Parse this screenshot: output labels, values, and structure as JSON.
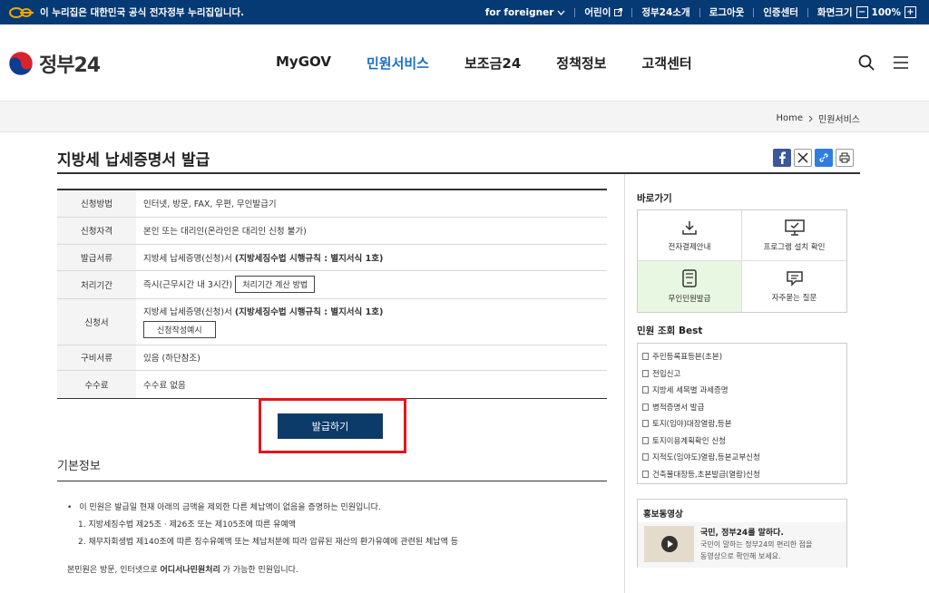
{
  "topbar": {
    "notice": "이 누리집은 대한민국 공식 전자정부 누리집입니다.",
    "for_foreigner": "for foreigner",
    "kids": "어린이",
    "about": "정부24소개",
    "logout": "로그아웃",
    "cert": "인증센터",
    "screen_size": "화면크기",
    "zoom": "100%"
  },
  "header": {
    "logo_text": "정부24",
    "nav": [
      "MyGOV",
      "민원서비스",
      "보조금24",
      "정책정보",
      "고객센터"
    ],
    "nav_active_index": 1,
    "accent_color": "#1e6fc8"
  },
  "breadcrumb": {
    "home": "Home",
    "current": "민원서비스"
  },
  "page": {
    "title": "지방세 납세증명서 발급"
  },
  "info": {
    "method_label": "신청방법",
    "method_value": "인터넷, 방문, FAX, 우편, 무인발급기",
    "qual_label": "신청자격",
    "qual_value": "본인 또는 대리인(온라인은 대리인 신청 불가)",
    "doc_label": "발급서류",
    "doc_value": "지방세 납세증명(신청)서 ",
    "doc_bold": "(지방세징수법 시행규칙 : 별지서식 1호)",
    "period_label": "처리기간",
    "period_value": "즉시(근무시간 내 3시간)",
    "period_btn": "처리기간 계산 방법",
    "form_label": "신청서",
    "form_value": "지방세 납세증명(신청)서 ",
    "form_bold": "(지방세징수법 시행규칙 : 별지서식 1호)",
    "form_btn": "신청작성예시",
    "req_label": "구비서류",
    "req_value": "있음 (하단참조)",
    "fee_label": "수수료",
    "fee_value": "수수료 없음"
  },
  "issue_button": "발급하기",
  "basic": {
    "title": "기본정보",
    "line1": "이 민원은 발급일 현재 아래의 금액을 제외한 다른 체납액이 없음을 증명하는 민원입니다.",
    "line2": "1. 지방세징수법 제25조 · 제26조 또는 제105조에 따른 유예액",
    "line3": "2. 채무자회생법 제140조에 따른 징수유예액 또는 체납처분에 따라 압류된 재산의 환가유예에 관련된 체납액 등",
    "note_prefix": "본민원은 방문, 인터넷으로 ",
    "note_bold": "어디서나민원처리",
    "note_suffix": " 가 가능한 민원입니다."
  },
  "sidebar": {
    "quick_title": "바로가기",
    "quick": [
      {
        "label": "전자결제안내",
        "icon": "download-icon"
      },
      {
        "label": "프로그램 설치 확인",
        "icon": "monitor-icon"
      },
      {
        "label": "무인민원발급",
        "icon": "kiosk-icon"
      },
      {
        "label": "자주묻는 질문",
        "icon": "chat-icon"
      }
    ],
    "best_title": "민원 조회 Best",
    "best": [
      "주민등록표등본(초본)",
      "전입신고",
      "지방세 세목별 과세증명",
      "병적증명서 발급",
      "토지(임야)대장열람,등본",
      "토지이용계획확인 신청",
      "지적도(임야도)열람,등본교부신청",
      "건축물대장등,초본발급(열람)신청"
    ],
    "promo_title": "홍보동영상",
    "promo_head": "국민, 정부24를 말하다.",
    "promo_desc1": "국민이 말하는 정부24의 편리한 점을",
    "promo_desc2": "동영상으로 확인해 보세요."
  }
}
